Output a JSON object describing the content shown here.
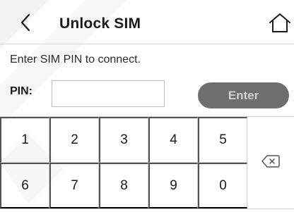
{
  "header": {
    "title": "Unlock SIM",
    "back_icon": "chevron-left-icon",
    "home_icon": "home-icon"
  },
  "prompt": {
    "instruction": "Enter SIM PIN to connect.",
    "pin_label": "PIN:",
    "pin_value": "",
    "enter_label": "Enter"
  },
  "keypad": {
    "keys": [
      "1",
      "2",
      "3",
      "4",
      "5",
      "6",
      "7",
      "8",
      "9",
      "0"
    ],
    "backspace_icon": "backspace-icon"
  },
  "colors": {
    "enter_button_bg": "#6e6e6e",
    "enter_button_text": "#d0d0d0",
    "divider": "#d0d0d0"
  }
}
